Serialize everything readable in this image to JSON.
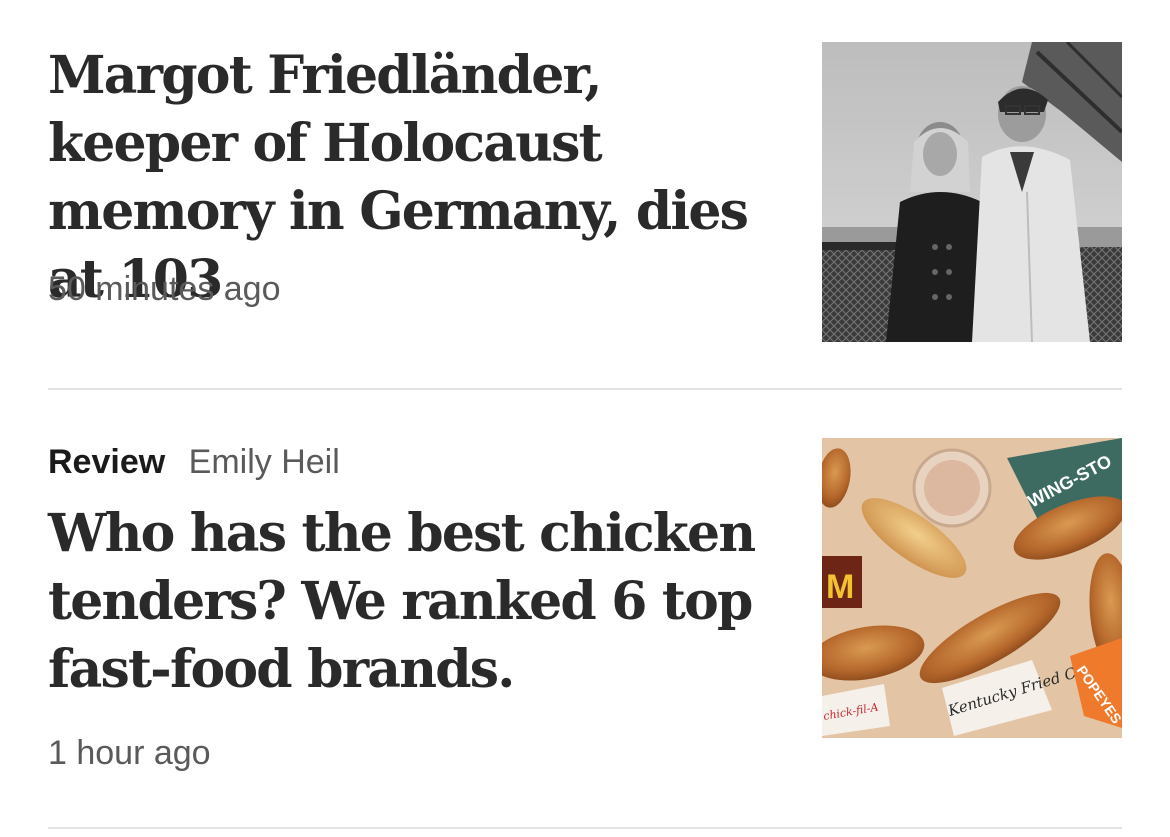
{
  "stories": [
    {
      "headline": "Margot Friedländer, keeper of Holocaust memory in Germany, dies at 103",
      "timestamp": "50 minutes ago"
    },
    {
      "kicker": "Review",
      "byline": "Emily Heil",
      "headline": "Who has the best chicken tenders? We ranked 6 top fast-food brands.",
      "timestamp": "1 hour ago",
      "image_labels": {
        "wingstop": "WING-STO",
        "kfc": "Kentucky Fried Chicken",
        "chickfila": "chick-fil-A",
        "popeyes": "POPEYES",
        "mcdonalds": "M"
      }
    }
  ]
}
